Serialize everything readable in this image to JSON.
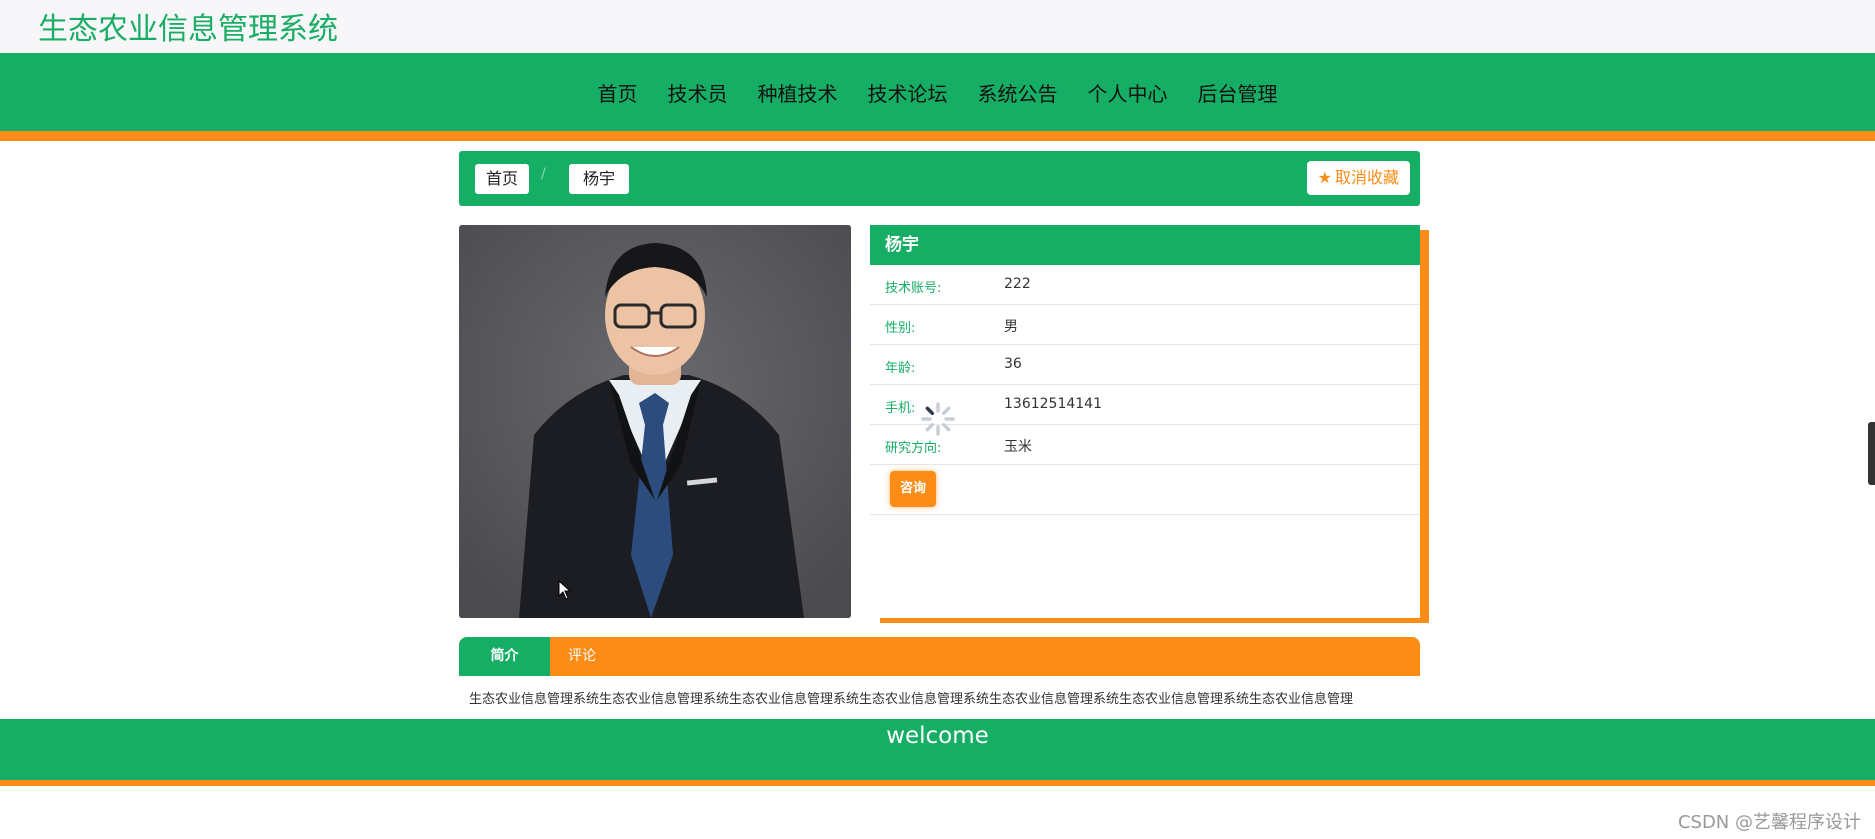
{
  "site": {
    "title": "生态农业信息管理系统"
  },
  "nav": {
    "items": [
      "首页",
      "技术员",
      "种植技术",
      "技术论坛",
      "系统公告",
      "个人中心",
      "后台管理"
    ]
  },
  "breadcrumb": {
    "home": "首页",
    "separator": "/",
    "current": "杨宇"
  },
  "favorite": {
    "label": "取消收藏",
    "icon": "star-icon"
  },
  "profile": {
    "name": "杨宇",
    "fields": [
      {
        "label": "技术账号:",
        "value": "222"
      },
      {
        "label": "性别:",
        "value": "男"
      },
      {
        "label": "年龄:",
        "value": "36"
      },
      {
        "label": "手机:",
        "value": "13612514141"
      },
      {
        "label": "研究方向:",
        "value": "玉米"
      }
    ],
    "consult_label": "咨询"
  },
  "tabs": {
    "intro": "简介",
    "comment": "评论"
  },
  "intro_text": "生态农业信息管理系统生态农业信息管理系统生态农业信息管理系统生态农业信息管理系统生态农业信息管理系统生态农业信息管理系统生态农业信息管理",
  "footer": {
    "text": "welcome"
  },
  "watermark": "CSDN @艺馨程序设计",
  "colors": {
    "primary": "#16ad64",
    "accent": "#fb8d17",
    "title": "#1aad65"
  }
}
